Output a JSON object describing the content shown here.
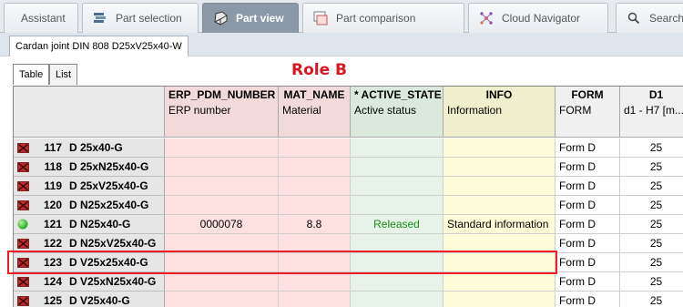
{
  "top_tabs": [
    {
      "label": "Assistant",
      "icon": "none",
      "active": false
    },
    {
      "label": "Part selection",
      "icon": "part-selection-icon",
      "active": false
    },
    {
      "label": "Part view",
      "icon": "part-view-icon",
      "active": true
    },
    {
      "label": "Part comparison",
      "icon": "part-comparison-icon",
      "active": false
    },
    {
      "label": "Cloud Navigator",
      "icon": "cloud-navigator-icon",
      "active": false
    },
    {
      "label": "Search",
      "icon": "search-icon",
      "active": false
    }
  ],
  "document_tab": "Cardan joint DIN 808 D25xV25x40-W",
  "view_tabs": [
    {
      "label": "Table",
      "active": true
    },
    {
      "label": "List",
      "active": false
    }
  ],
  "annotation": "Role B",
  "columns": [
    {
      "name": "ERP_PDM_NUMBER",
      "description": "ERP number",
      "color": "red"
    },
    {
      "name": "MAT_NAME",
      "description": "Material",
      "color": "red"
    },
    {
      "name": "* ACTIVE_STATE",
      "description": "Active status",
      "color": "green"
    },
    {
      "name": "INFO",
      "description": "Information",
      "color": "yellow"
    },
    {
      "name": "FORM",
      "description": "FORM",
      "color": "plain"
    },
    {
      "name": "D1",
      "description": "d1 - H7 [m...",
      "color": "plain"
    }
  ],
  "rows": [
    {
      "number": "117",
      "name": "D 25x40-G",
      "status": "inactive",
      "erp": "",
      "material": "",
      "state": "",
      "info": "",
      "form": "Form D",
      "d1": "25"
    },
    {
      "number": "118",
      "name": "D 25xN25x40-G",
      "status": "inactive",
      "erp": "",
      "material": "",
      "state": "",
      "info": "",
      "form": "Form D",
      "d1": "25"
    },
    {
      "number": "119",
      "name": "D 25xV25x40-G",
      "status": "inactive",
      "erp": "",
      "material": "",
      "state": "",
      "info": "",
      "form": "Form D",
      "d1": "25"
    },
    {
      "number": "120",
      "name": "D N25x25x40-G",
      "status": "inactive",
      "erp": "",
      "material": "",
      "state": "",
      "info": "",
      "form": "Form D",
      "d1": "25"
    },
    {
      "number": "121",
      "name": "D N25x40-G",
      "status": "active",
      "erp": "0000078",
      "material": "8.8",
      "state": "Released",
      "info": "Standard information",
      "form": "Form D",
      "d1": "25"
    },
    {
      "number": "122",
      "name": "D N25xV25x40-G",
      "status": "inactive",
      "erp": "",
      "material": "",
      "state": "",
      "info": "",
      "form": "Form D",
      "d1": "25"
    },
    {
      "number": "123",
      "name": "D V25x25x40-G",
      "status": "inactive",
      "erp": "",
      "material": "",
      "state": "",
      "info": "",
      "form": "Form D",
      "d1": "25"
    },
    {
      "number": "124",
      "name": "D V25xN25x40-G",
      "status": "inactive",
      "erp": "",
      "material": "",
      "state": "",
      "info": "",
      "form": "Form D",
      "d1": "25"
    },
    {
      "number": "125",
      "name": "D V25x40-G",
      "status": "inactive",
      "erp": "",
      "material": "",
      "state": "",
      "info": "",
      "form": "Form D",
      "d1": "25"
    }
  ],
  "colors": {
    "highlight_border": "#ee1c24",
    "annotation_text": "#e0141e",
    "released_text": "#1a8a1a",
    "active_status": "#22aa22",
    "inactive_status": "#c0282c"
  }
}
